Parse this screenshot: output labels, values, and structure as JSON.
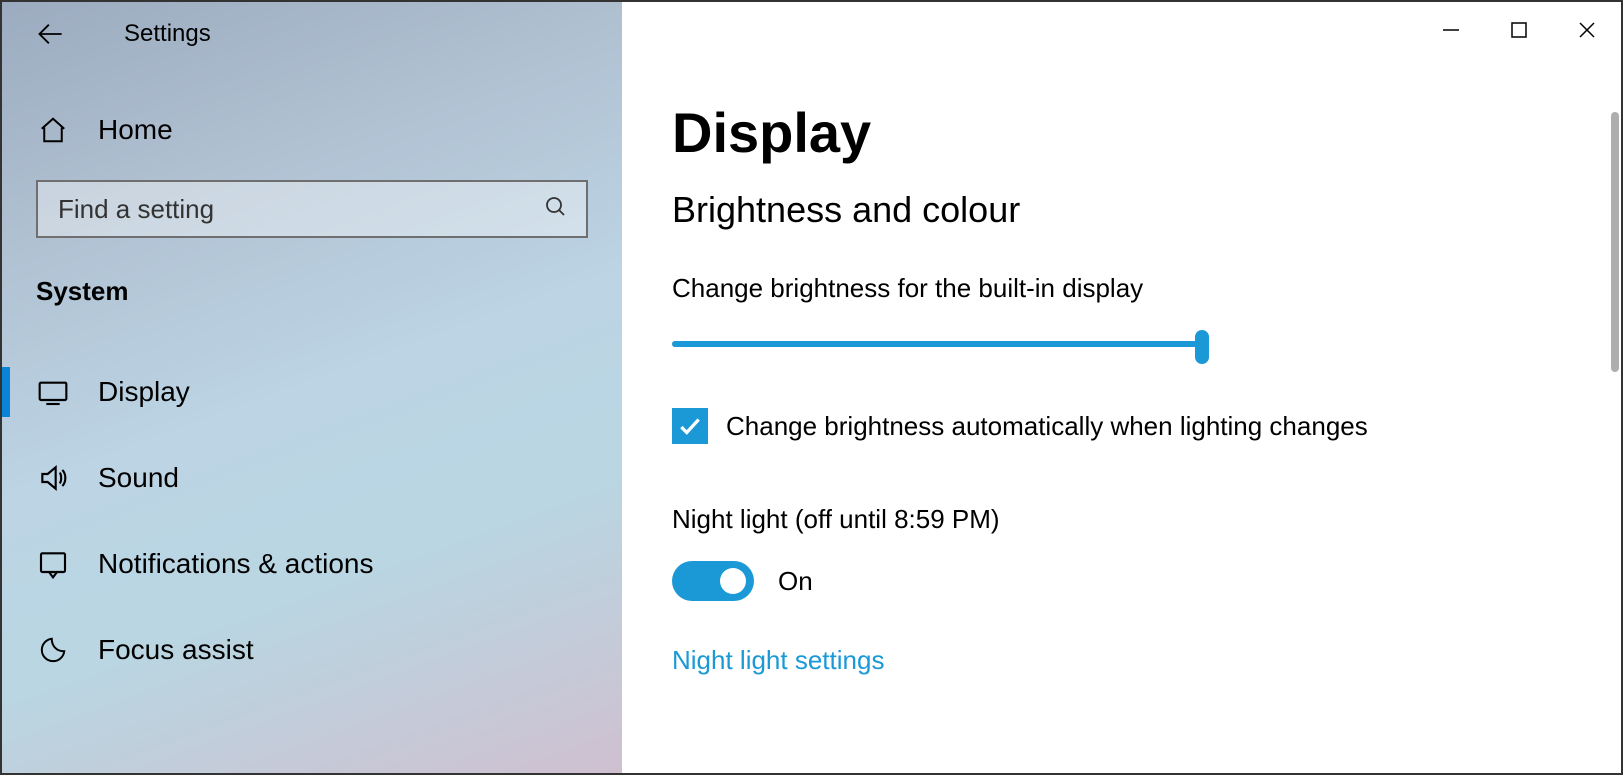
{
  "header": {
    "title": "Settings"
  },
  "sidebar": {
    "home_label": "Home",
    "search_placeholder": "Find a setting",
    "category": "System",
    "items": [
      {
        "label": "Display",
        "icon": "display-icon",
        "selected": true
      },
      {
        "label": "Sound",
        "icon": "sound-icon",
        "selected": false
      },
      {
        "label": "Notifications & actions",
        "icon": "notifications-icon",
        "selected": false
      },
      {
        "label": "Focus assist",
        "icon": "focus-assist-icon",
        "selected": false
      }
    ]
  },
  "main": {
    "page_title": "Display",
    "section_title": "Brightness and colour",
    "brightness_label": "Change brightness for the built-in display",
    "brightness_value_percent": 100,
    "auto_brightness_label": "Change brightness automatically when lighting changes",
    "auto_brightness_checked": true,
    "night_light_label": "Night light (off until 8:59 PM)",
    "night_light_state_label": "On",
    "night_light_on": true,
    "night_light_settings_link": "Night light settings"
  },
  "colors": {
    "accent": "#1a99d6"
  }
}
